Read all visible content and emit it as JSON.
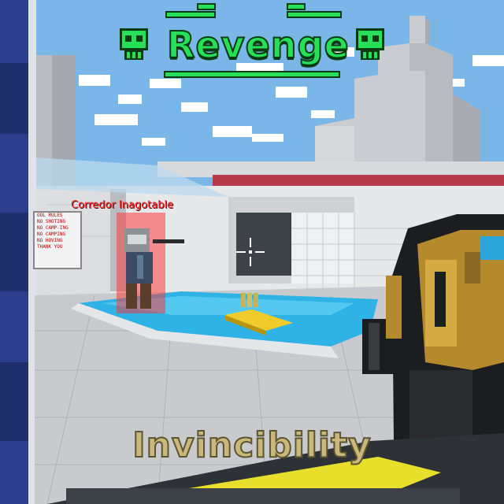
{
  "hud": {
    "banner_text": "Revenge",
    "player_name": "Corredor Inagotable",
    "status_text": "Invincibility",
    "crosshair_icon": "crosshair-icon",
    "skull_icon": "skull-icon"
  },
  "sign": {
    "lines": [
      "OOL RULES",
      "NO SHOTING",
      "NO CAMP-ING",
      "NO CAMPING",
      "NO HOVING",
      "THANK YOU"
    ]
  },
  "colors": {
    "banner_green": "#27e05a",
    "enemy_red": "#ff2a2a",
    "status_tan": "#c9b87a",
    "sky": "#7ab6e8",
    "pool_water": "#2fb3e6"
  }
}
